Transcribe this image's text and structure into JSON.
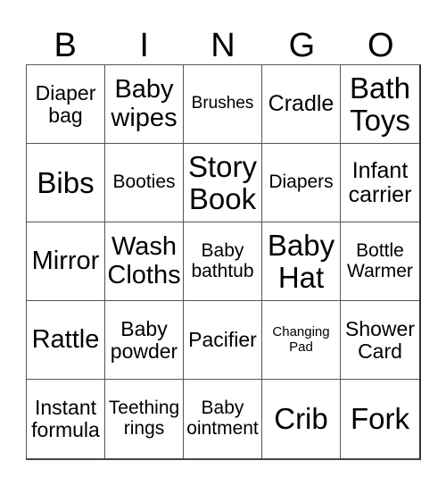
{
  "title": {
    "letters": [
      "B",
      "I",
      "N",
      "G",
      "O"
    ]
  },
  "card": {
    "rows": [
      [
        {
          "text": "Diaper\nbag",
          "size": "s-ms"
        },
        {
          "text": "Baby\nwipes",
          "size": "s-l"
        },
        {
          "text": "Brushes",
          "size": "s-xs"
        },
        {
          "text": "Cradle",
          "size": "s-m"
        },
        {
          "text": "Bath\nToys",
          "size": "s-xl"
        }
      ],
      [
        {
          "text": "Bibs",
          "size": "s-xl"
        },
        {
          "text": "Booties",
          "size": "s-s"
        },
        {
          "text": "Story\nBook",
          "size": "s-xl"
        },
        {
          "text": "Diapers",
          "size": "s-s"
        },
        {
          "text": "Infant\ncarrier",
          "size": "s-m"
        }
      ],
      [
        {
          "text": "Mirror",
          "size": "s-l"
        },
        {
          "text": "Wash\nCloths",
          "size": "s-l"
        },
        {
          "text": "Baby\nbathtub",
          "size": "s-s"
        },
        {
          "text": "Baby\nHat",
          "size": "s-xl"
        },
        {
          "text": "Bottle\nWarmer",
          "size": "s-s"
        }
      ],
      [
        {
          "text": "Rattle",
          "size": "s-l"
        },
        {
          "text": "Baby\npowder",
          "size": "s-ms"
        },
        {
          "text": "Pacifier",
          "size": "s-ms"
        },
        {
          "text": "Changing\nPad",
          "size": "s-xxs"
        },
        {
          "text": "Shower\nCard",
          "size": "s-ms"
        }
      ],
      [
        {
          "text": "Instant\nformula",
          "size": "s-ms"
        },
        {
          "text": "Teething\nrings",
          "size": "s-s"
        },
        {
          "text": "Baby\nointment",
          "size": "s-s"
        },
        {
          "text": "Crib",
          "size": "s-xl"
        },
        {
          "text": "Fork",
          "size": "s-xl"
        }
      ]
    ]
  }
}
